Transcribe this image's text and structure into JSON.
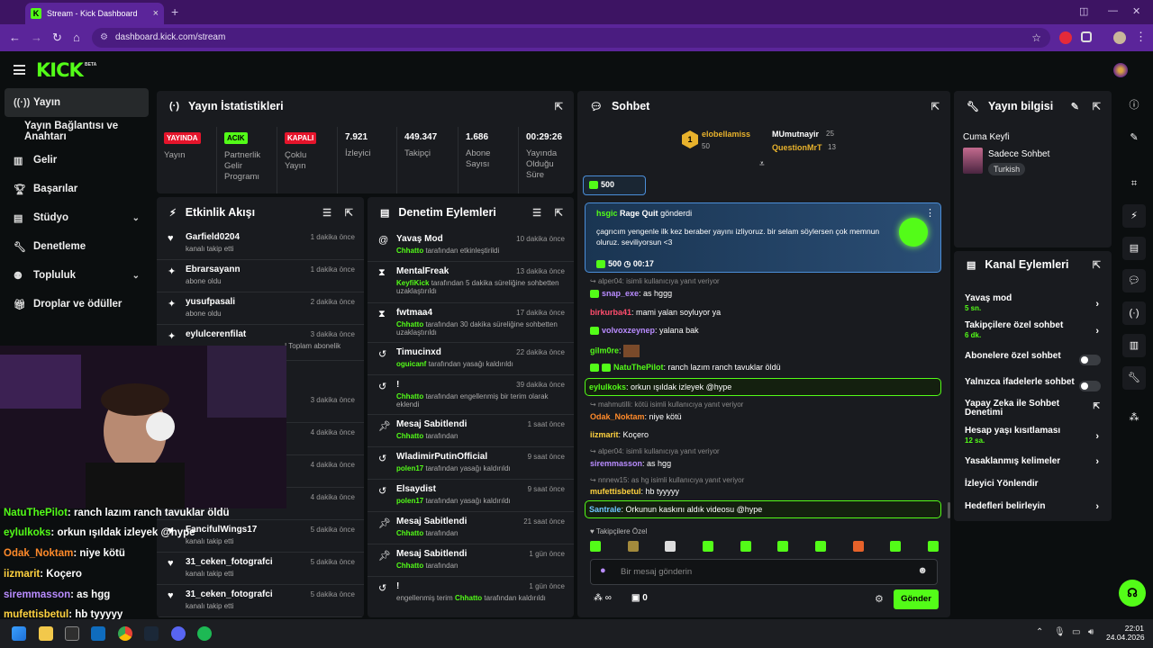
{
  "browser": {
    "tab_title": "Stream - Kick Dashboard",
    "url": "dashboard.kick.com/stream"
  },
  "header": {
    "logo": "KICK",
    "beta": "BETA"
  },
  "sidebar": {
    "items": [
      {
        "label": "Yayın",
        "icon": "broadcast-icon"
      },
      {
        "label": "Yayın Bağlantısı ve Anahtarı",
        "icon": ""
      },
      {
        "label": "Gelir",
        "icon": "chart-icon"
      },
      {
        "label": "Başarılar",
        "icon": "trophy-icon"
      },
      {
        "label": "Stüdyo",
        "icon": "studio-icon"
      },
      {
        "label": "Denetleme",
        "icon": "wrench-icon"
      },
      {
        "label": "Topluluk",
        "icon": "community-icon"
      },
      {
        "label": "Droplar ve ödüller",
        "icon": "gift-icon"
      }
    ]
  },
  "stats": {
    "title": "Yayın İstatistikleri",
    "items": [
      {
        "badge": "YAYINDA",
        "badge_color": "#e5142b",
        "label": "Yayın"
      },
      {
        "badge": "ACIK",
        "badge_color": "#53fc18",
        "label": "Partnerlik Gelir Programı"
      },
      {
        "badge": "KAPALI",
        "badge_color": "#e5142b",
        "label": "Çoklu Yayın"
      },
      {
        "value": "7.921",
        "label": "İzleyici"
      },
      {
        "value": "449.347",
        "label": "Takipçi"
      },
      {
        "value": "1.686",
        "label": "Abone Sayısı"
      },
      {
        "value": "00:29:26",
        "label": "Yayında Olduğu Süre"
      }
    ]
  },
  "activity": {
    "title": "Etkinlik Akışı",
    "items": [
      {
        "name": "Garfield0204",
        "sub": "kanalı takip etti",
        "time": "1 dakika önce",
        "icon": "heart-icon"
      },
      {
        "name": "Ebrarsayann",
        "sub": "abone oldu",
        "time": "1 dakika önce",
        "icon": "sparkle-icon"
      },
      {
        "name": "yusufpasali",
        "sub": "abone oldu",
        "time": "2 dakika önce",
        "icon": "sparkle-icon"
      },
      {
        "name": "eylulcerenfilat",
        "sub": "! Toplam abonelik",
        "time": "3 dakika önce",
        "icon": "sparkle-icon"
      },
      {
        "name": "",
        "sub": "",
        "time": "3 dakika önce",
        "icon": "heart-icon"
      },
      {
        "name": "",
        "sub": "",
        "time": "4 dakika önce",
        "icon": "heart-icon"
      },
      {
        "name": "",
        "sub": "",
        "time": "4 dakika önce",
        "icon": "heart-icon"
      },
      {
        "name": "",
        "sub": "",
        "time": "4 dakika önce",
        "icon": "heart-icon"
      },
      {
        "name": "FancifulWings17",
        "sub": "kanalı takip etti",
        "time": "5 dakika önce",
        "icon": "heart-icon"
      },
      {
        "name": "31_ceken_fotografci",
        "sub": "kanalı takip etti",
        "time": "5 dakika önce",
        "icon": "heart-icon"
      },
      {
        "name": "31_ceken_fotografci",
        "sub": "kanalı takip etti",
        "time": "5 dakika önce",
        "icon": "heart-icon"
      }
    ]
  },
  "moderation": {
    "title": "Denetim Eylemleri",
    "items": [
      {
        "name": "Yavaş Mod",
        "actor": "Chhatto",
        "sub": "tarafından etkinleştirildi",
        "time": "10 dakika önce",
        "icon": "snail-icon"
      },
      {
        "name": "MentalFreak",
        "actor": "KeyfiKick",
        "sub": "tarafından 5 dakika süreliğine sohbetten uzaklaştırıldı",
        "time": "13 dakika önce",
        "icon": "hourglass-icon"
      },
      {
        "name": "fwtmaa4",
        "actor": "Chhatto",
        "sub": "tarafından 30 dakika süreliğine sohbetten uzaklaştırıldı",
        "time": "17 dakika önce",
        "icon": "hourglass-icon"
      },
      {
        "name": "Timucinxd",
        "actor": "oguicanf",
        "sub": "tarafından yasağı kaldırıldı",
        "time": "22 dakika önce",
        "icon": "undo-icon"
      },
      {
        "name": "!",
        "actor": "Chhatto",
        "sub": "tarafından engellenmiş bir terim olarak eklendi",
        "time": "39 dakika önce",
        "icon": "undo-icon"
      },
      {
        "name": "Mesaj Sabitlendi",
        "actor": "Chhatto",
        "sub": "tarafından",
        "time": "1 saat önce",
        "icon": "pin-icon"
      },
      {
        "name": "WladimirPutinOfficial",
        "actor": "polen17",
        "sub": "tarafından yasağı kaldırıldı",
        "time": "9 saat önce",
        "icon": "undo-icon"
      },
      {
        "name": "Elsaydist",
        "actor": "polen17",
        "sub": "tarafından yasağı kaldırıldı",
        "time": "9 saat önce",
        "icon": "undo-icon"
      },
      {
        "name": "Mesaj Sabitlendi",
        "actor": "Chhatto",
        "sub": "tarafından",
        "time": "21 saat önce",
        "icon": "pin-icon"
      },
      {
        "name": "Mesaj Sabitlendi",
        "actor": "Chhatto",
        "sub": "tarafından",
        "time": "1 gün önce",
        "icon": "pin-icon"
      },
      {
        "name": "!",
        "actor": "Chhatto",
        "sub": "tarafından kaldırıldı",
        "pre": "engellenmiş terim",
        "time": "1 gün önce",
        "icon": "undo-icon"
      }
    ]
  },
  "chat": {
    "title": "Sohbet",
    "top_gifters": [
      {
        "name": "elobellamiss",
        "amount": "50"
      },
      {
        "name": "MUmutnayir",
        "amount": "25"
      },
      {
        "name": "QuestionMrT",
        "amount": "13"
      }
    ],
    "kicks_badge": "500",
    "pinned": {
      "user": "hsgic",
      "item": "Rage Quit",
      "verb": "gönderdi",
      "text": "çagrıcım yengenle ilk kez beraber yayını izliyoruz. bir selam söylersen çok memnun oluruz. seviliyorsun <3",
      "kicks": "500",
      "timer": "00:17"
    },
    "messages": [
      {
        "reply": "alper04:",
        "reply_text": "isimli kullanıcıya yanıt veriyor"
      },
      {
        "name": "snap_exe",
        "color": "#b98cff",
        "text": "as hggg"
      },
      {
        "name": "birkurba41",
        "color": "#ff4d6d",
        "text": "mami yalan soyluyor ya"
      },
      {
        "name": "volvoxzeynep",
        "color": "#b98cff",
        "text": "yalana bak"
      },
      {
        "name": "gilm0re",
        "color": "#53fc18",
        "text": ""
      },
      {
        "name": "NatuThePilot",
        "color": "#53fc18",
        "text": "ranch lazım ranch tavuklar öldü"
      },
      {
        "name": "eylulkoks",
        "color": "#53fc18",
        "text": "orkun ışıldak izleyek @hype",
        "highlight": true
      },
      {
        "reply": "mahmutilli:",
        "reply_text": "kötü isimli kullanıcıya yanıt veriyor"
      },
      {
        "name": "Odak_Noktam",
        "color": "#ff8a2a",
        "text": "niye kötü"
      },
      {
        "name": "iizmarit",
        "color": "#ffd23f",
        "text": "Koçero"
      },
      {
        "reply": "alper04:",
        "reply_text": "isimli kullanıcıya yanıt veriyor"
      },
      {
        "name": "siremmasson",
        "color": "#b98cff",
        "text": "as hgg"
      },
      {
        "reply": "nnnew15:",
        "reply_text": "as hg isimli kullanıcıya yanıt veriyor"
      },
      {
        "name": "mufettisbetul",
        "color": "#ffd23f",
        "text": "hb tyyyyy"
      },
      {
        "name": "Santrale",
        "color": "#6ec6ff",
        "text": "Orkunun kaskını aldık videosu @hype",
        "highlight": true
      }
    ],
    "followers_only": "Takipçilere Özel",
    "input_placeholder": "Bir mesaj gönderin",
    "kicks_count": "0",
    "send_label": "Gönder"
  },
  "stream_info": {
    "title": "Yayın bilgisi",
    "stream_title": "Cuma Keyfi",
    "category": "Sadece Sohbet",
    "language": "Turkish"
  },
  "channel_actions": {
    "title": "Kanal Eylemleri",
    "items": [
      {
        "label": "Yavaş mod",
        "sub": "5 sn.",
        "control": "chevron"
      },
      {
        "label": "Takipçilere özel sohbet",
        "sub": "6 dk.",
        "control": "chevron"
      },
      {
        "label": "Abonelere özel sohbet",
        "sub": "",
        "control": "toggle"
      },
      {
        "label": "Yalnızca ifadelerle sohbet",
        "sub": "",
        "control": "toggle"
      },
      {
        "label": "Yapay Zeka ile Sohbet Denetimi",
        "sub": "",
        "control": "external"
      },
      {
        "label": "Hesap yaşı kısıtlaması",
        "sub": "12 sa.",
        "control": "chevron"
      },
      {
        "label": "Yasaklanmış kelimeler",
        "sub": "",
        "control": "chevron"
      },
      {
        "label": "İzleyici Yönlendir",
        "sub": "",
        "control": "none"
      },
      {
        "label": "Hedefleri belirleyin",
        "sub": "",
        "control": "chevron"
      }
    ]
  },
  "overlay_chat": [
    {
      "name": "NatuThePilot",
      "color": "#53fc18",
      "text": ": ranch lazım ranch tavuklar öldü"
    },
    {
      "name": "eylulkoks",
      "color": "#53fc18",
      "text": ": orkun ışıldak izleyek @hype"
    },
    {
      "name": "Odak_Noktam",
      "color": "#ff8a2a",
      "text": ": niye kötü"
    },
    {
      "name": "iizmarit",
      "color": "#ffd23f",
      "text": ": Koçero"
    },
    {
      "name": "siremmasson",
      "color": "#b98cff",
      "text": ": as hgg"
    },
    {
      "name": "mufettisbetul",
      "color": "#ffd23f",
      "text": ": hb tyyyyy"
    }
  ],
  "taskbar": {
    "time": "22:01",
    "date": "24.04.2026"
  },
  "colors": {
    "accent": "#53fc18",
    "panel": "#191b1f",
    "browser": "#5b259a"
  }
}
